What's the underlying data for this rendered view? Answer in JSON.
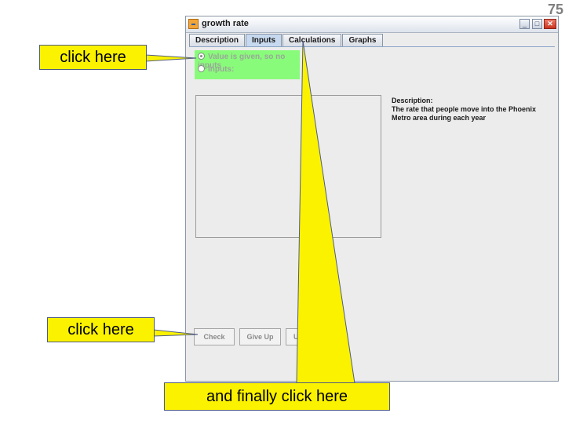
{
  "slide_number": "75",
  "window": {
    "title": "growth rate",
    "minimize_glyph": "_",
    "maximize_glyph": "□",
    "close_glyph": "✕"
  },
  "tabs": [
    {
      "label": "Description",
      "active": false
    },
    {
      "label": "Inputs",
      "active": true
    },
    {
      "label": "Calculations",
      "active": false
    },
    {
      "label": "Graphs",
      "active": false
    }
  ],
  "radio": {
    "option1": "Value is given, so no inputs",
    "option1_selected": true,
    "option2": "Inputs:",
    "option2_selected": false,
    "panel_color": "#89fb7a"
  },
  "description": {
    "heading": "Description:",
    "text": "The rate that people move into the Phoenix Metro area during each year"
  },
  "buttons": {
    "check": "Check",
    "give_up": "Give Up",
    "third": "U"
  },
  "callouts": {
    "top": "click here",
    "middle": "click here",
    "bottom": "and finally click here",
    "color": "#fbf200"
  }
}
